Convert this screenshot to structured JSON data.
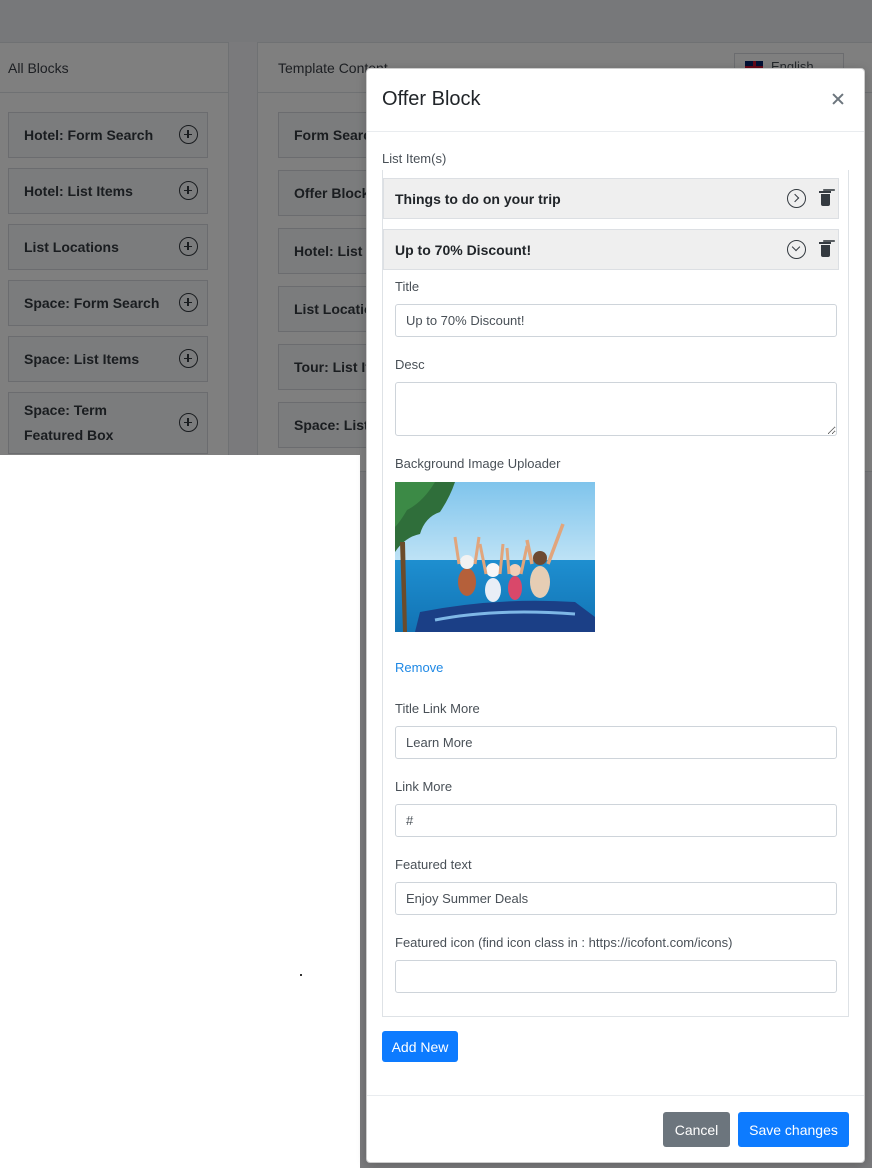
{
  "background": {
    "all_blocks": {
      "title": "All Blocks",
      "items": [
        "Hotel: Form Search",
        "Hotel: List Items",
        "List Locations",
        "Space: Form Search",
        "Space: List Items",
        "Space: Term Featured Box"
      ]
    },
    "template_content": {
      "title": "Template Content",
      "items": [
        "Form Search",
        "Offer Block",
        "Hotel: List It",
        "List Location",
        "Tour: List Ite",
        "Space: List I"
      ]
    },
    "language": "English"
  },
  "modal": {
    "title": "Offer Block",
    "list_label": "List Item(s)",
    "items": [
      {
        "title": "Things to do on your trip",
        "expanded": false
      },
      {
        "title": "Up to 70% Discount!",
        "expanded": true
      }
    ],
    "form": {
      "title_label": "Title",
      "title_value": "Up to 70% Discount!",
      "desc_label": "Desc",
      "desc_value": "",
      "bg_image_label": "Background Image Uploader",
      "remove_label": "Remove",
      "title_link_more_label": "Title Link More",
      "title_link_more_value": "Learn More",
      "link_more_label": "Link More",
      "link_more_value": "#",
      "featured_text_label": "Featured text",
      "featured_text_value": "Enjoy Summer Deals",
      "featured_icon_label": "Featured icon (find icon class in : https://icofont.com/icons)",
      "featured_icon_value": ""
    },
    "add_new_label": "Add New",
    "cancel_label": "Cancel",
    "save_label": "Save changes"
  },
  "colors": {
    "primary": "#0d7bff",
    "secondary": "#6c757d",
    "link": "#1e88e5"
  }
}
